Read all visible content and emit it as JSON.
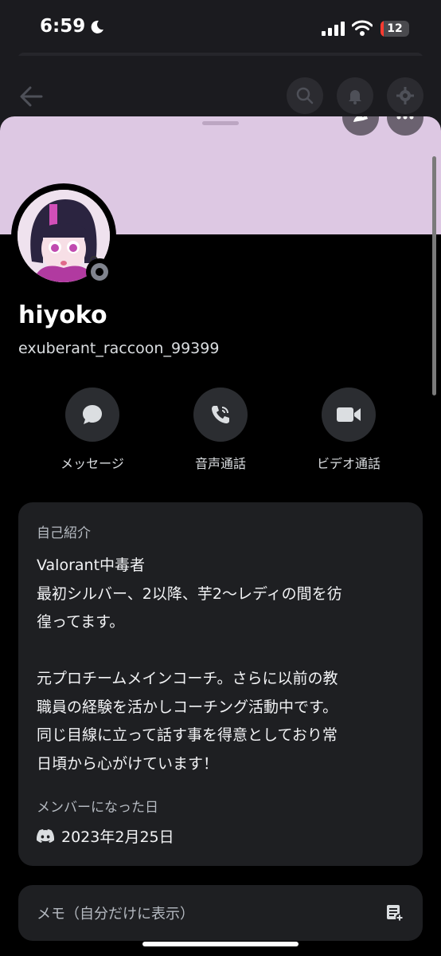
{
  "status_bar": {
    "time": "6:59",
    "battery": "12",
    "battery_level": 0.12
  },
  "header": {
    "back_icon": "arrow-left-icon",
    "search_icon": "search-icon",
    "bell_icon": "bell-icon",
    "settings_icon": "gear-icon"
  },
  "profile": {
    "display_name": "hiyoko",
    "username": "exuberant_raccoon_99399",
    "status": "offline",
    "banner_color": "#ddc8e3"
  },
  "actions": [
    {
      "label": "メッセージ",
      "icon": "chat-bubble-icon"
    },
    {
      "label": "音声通話",
      "icon": "phone-icon"
    },
    {
      "label": "ビデオ通話",
      "icon": "video-camera-icon"
    }
  ],
  "about": {
    "heading": "自己紹介",
    "lines": [
      "Valorant中毒者",
      "最初シルバー、2以降、芋2〜レディの間を彷",
      "徨ってます。",
      "",
      "元プロチームメインコーチ。さらに以前の教",
      "職員の経験を活かしコーチング活動中です。",
      "同じ目線に立って話す事を得意としており常",
      "日頃から心がけています！"
    ],
    "member_since_heading": "メンバーになった日",
    "member_since_date": "2023年2月25日"
  },
  "note": {
    "placeholder": "メモ（自分だけに表示）",
    "icon": "note-edit-icon"
  },
  "colors": {
    "accent_status_red": "#ff3b30",
    "card_bg": "#1e1f22"
  }
}
